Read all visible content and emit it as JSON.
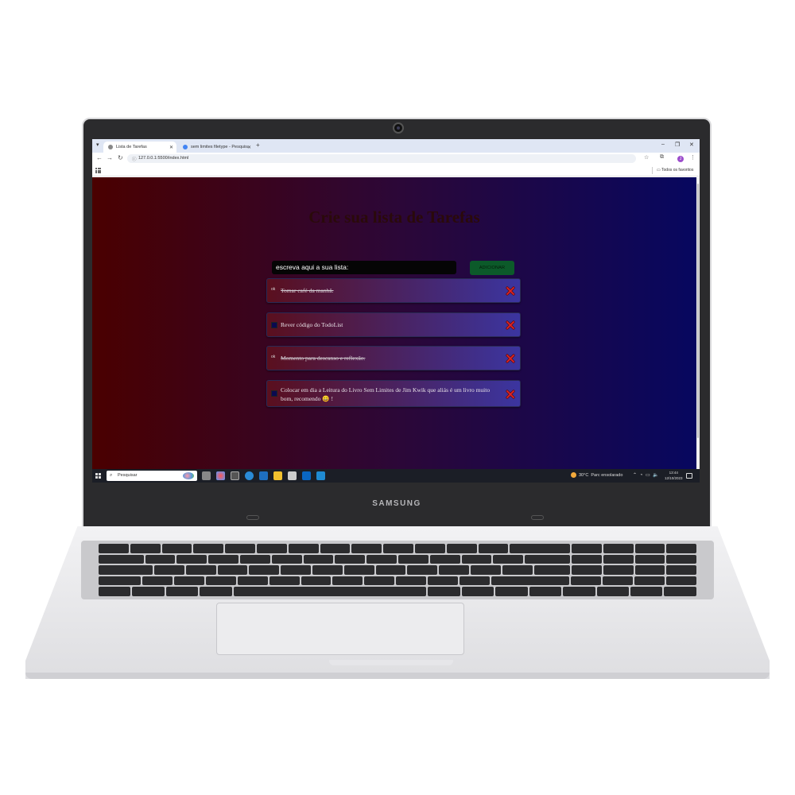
{
  "laptop": {
    "brand": "SAMSUNG"
  },
  "browser": {
    "tabs": [
      {
        "label": "Lista de Tarefas",
        "active": true
      },
      {
        "label": "sem limites filetype - Pesquisa",
        "active": false
      }
    ],
    "new_tab": "+",
    "url": "127.0.0.1:5500/index.html",
    "bookmark_folder": "Todos os favoritos",
    "profile_initial": "J"
  },
  "app": {
    "title": "Crie sua lista de Tarefas",
    "input_value": "escreva aqui a sua lista:",
    "add_label": "ADICIONAR",
    "tasks": [
      {
        "text": "Tomar café da manhã.",
        "done": true,
        "check_label": "ok"
      },
      {
        "text": "Rever código do TodoList",
        "done": false,
        "check_label": ""
      },
      {
        "text": "Momento para descanso e reflexão.",
        "done": true,
        "check_label": "ok"
      },
      {
        "text": "Colocar em dia a Leitura do Livro Sem Limites de Jim Kwik que aliás é um livro muito bom, recomendo 😄 !",
        "done": false,
        "check_label": ""
      }
    ],
    "colors": {
      "bg_left": "#4a0000",
      "bg_right": "#07075f",
      "add_button": "#0c5a2a",
      "delete_icon": "#d42020"
    }
  },
  "taskbar": {
    "search_placeholder": "Pesquisar",
    "weather_temp": "30°C",
    "weather_desc": "Parc ensolarado",
    "time": "13:44",
    "date": "12/10/2023"
  }
}
